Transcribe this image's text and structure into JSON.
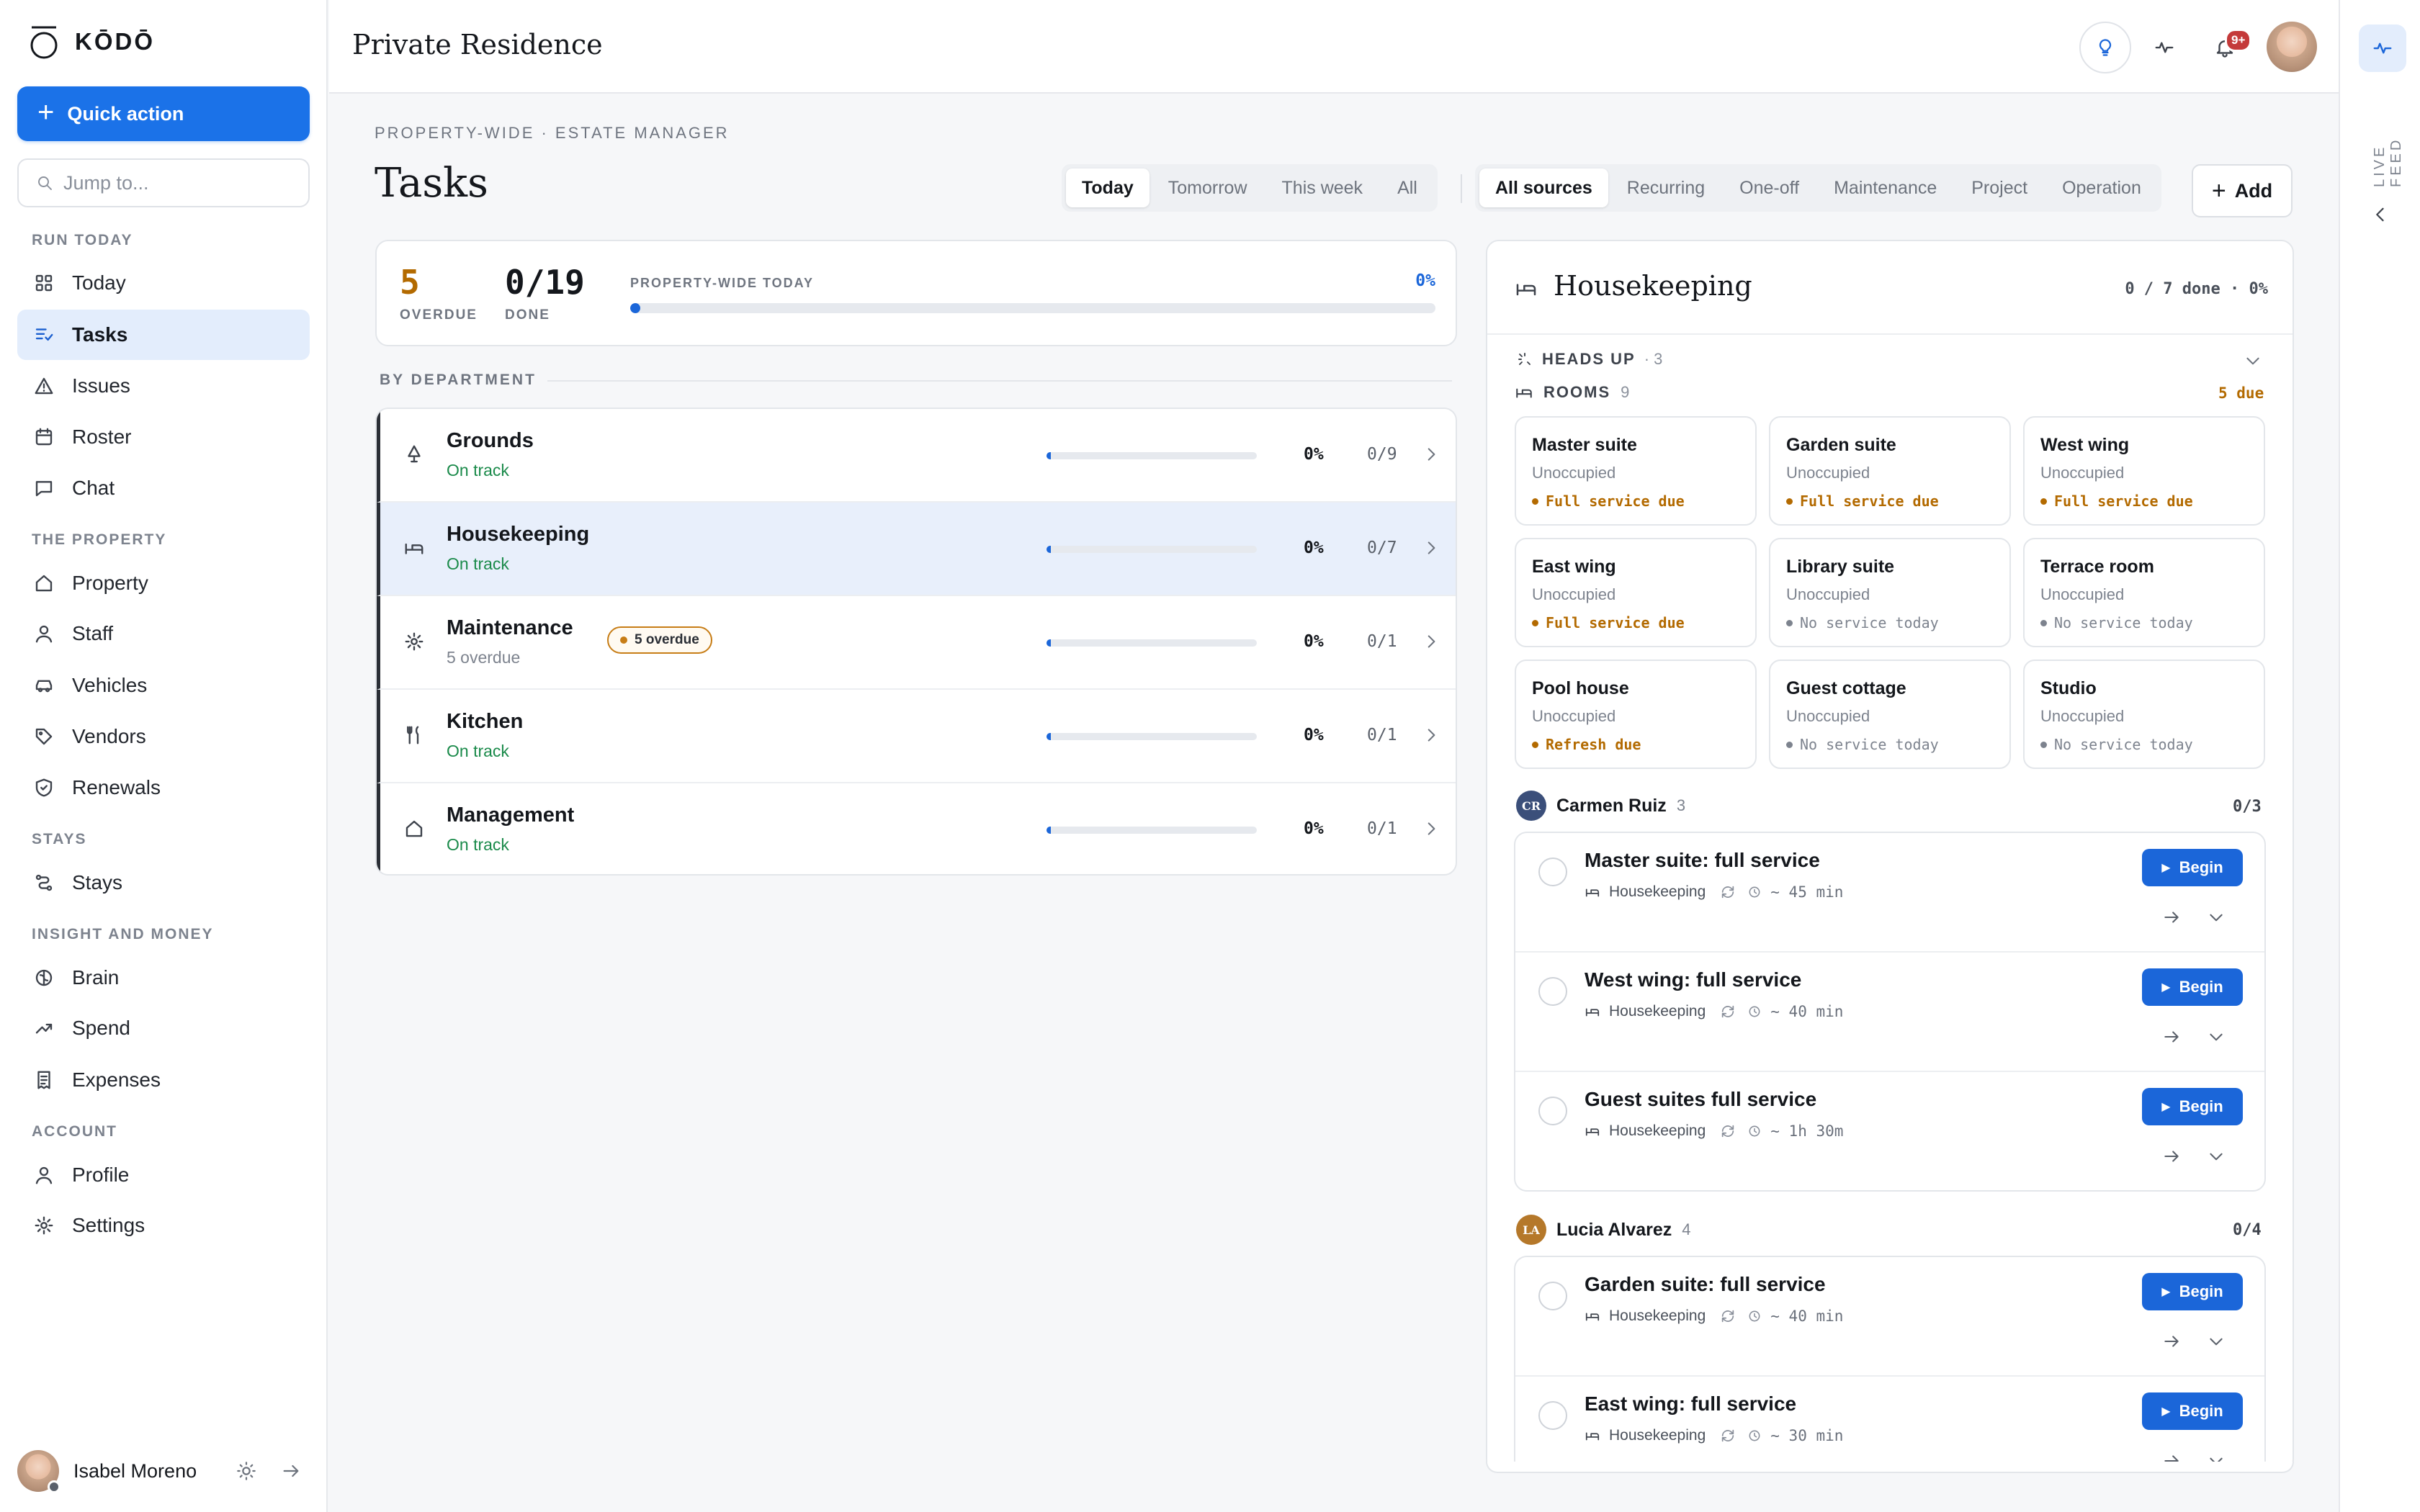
{
  "app": {
    "name": "KŌDŌ"
  },
  "sidebar": {
    "quick_action": "Quick action",
    "jump_placeholder": "Jump to...",
    "sections": {
      "run_today": "RUN TODAY",
      "the_property": "THE PROPERTY",
      "stays": "STAYS",
      "insight": "INSIGHT AND MONEY",
      "account": "ACCOUNT"
    },
    "items": {
      "today": "Today",
      "tasks": "Tasks",
      "issues": "Issues",
      "roster": "Roster",
      "chat": "Chat",
      "property": "Property",
      "staff": "Staff",
      "vehicles": "Vehicles",
      "vendors": "Vendors",
      "renewals": "Renewals",
      "stays": "Stays",
      "brain": "Brain",
      "spend": "Spend",
      "expenses": "Expenses",
      "profile": "Profile",
      "settings": "Settings"
    },
    "user": "Isabel Moreno"
  },
  "header": {
    "title": "Private Residence",
    "notif_badge": "9+"
  },
  "rail": {
    "label": "LIVE FEED"
  },
  "page": {
    "crumb": "PROPERTY-WIDE · ESTATE MANAGER",
    "title": "Tasks",
    "time_filters": [
      "Today",
      "Tomorrow",
      "This week",
      "All"
    ],
    "source_filters": [
      "All sources",
      "Recurring",
      "One-off",
      "Maintenance",
      "Project",
      "Operation"
    ],
    "add": "Add"
  },
  "summary": {
    "overdue": "5",
    "overdue_label": "OVERDUE",
    "done": "0/19",
    "done_label": "DONE",
    "progress_label": "PROPERTY-WIDE TODAY",
    "progress_pct": "0%",
    "progress_value": 0
  },
  "by_department": "BY DEPARTMENT",
  "departments": [
    {
      "name": "Grounds",
      "status": "On track",
      "pct": "0%",
      "count": "0/9"
    },
    {
      "name": "Housekeeping",
      "status": "On track",
      "pct": "0%",
      "count": "0/7"
    },
    {
      "name": "Maintenance",
      "status": "5 overdue",
      "badge": "5 overdue",
      "pct": "0%",
      "count": "0/1"
    },
    {
      "name": "Kitchen",
      "status": "On track",
      "pct": "0%",
      "count": "0/1"
    },
    {
      "name": "Management",
      "status": "On track",
      "pct": "0%",
      "count": "0/1"
    }
  ],
  "detail": {
    "title": "Housekeeping",
    "done": "0 / 7 done · 0%",
    "heads_up": "HEADS UP",
    "heads_up_count": "· 3",
    "rooms_label": "ROOMS",
    "rooms_count": "9",
    "rooms_due": "5 due",
    "rooms": [
      {
        "name": "Master suite",
        "occ": "Unoccupied",
        "status": "Full service due"
      },
      {
        "name": "Garden suite",
        "occ": "Unoccupied",
        "status": "Full service due"
      },
      {
        "name": "West wing",
        "occ": "Unoccupied",
        "status": "Full service due"
      },
      {
        "name": "East wing",
        "occ": "Unoccupied",
        "status": "Full service due"
      },
      {
        "name": "Library suite",
        "occ": "Unoccupied",
        "status": "No service today"
      },
      {
        "name": "Terrace room",
        "occ": "Unoccupied",
        "status": "No service today"
      },
      {
        "name": "Pool house",
        "occ": "Unoccupied",
        "status": "Refresh due"
      },
      {
        "name": "Guest cottage",
        "occ": "Unoccupied",
        "status": "No service today"
      },
      {
        "name": "Studio",
        "occ": "Unoccupied",
        "status": "No service today"
      }
    ],
    "people": [
      {
        "initials": "CR",
        "name": "Carmen Ruiz",
        "count": "3",
        "done": "0/3",
        "color": "#3b4f7a",
        "tasks": [
          {
            "title": "Master suite: full service",
            "dept": "Housekeeping",
            "dur": "~ 45 min"
          },
          {
            "title": "West wing: full service",
            "dept": "Housekeeping",
            "dur": "~ 40 min"
          },
          {
            "title": "Guest suites full service",
            "dept": "Housekeeping",
            "dur": "~ 1h 30m"
          }
        ]
      },
      {
        "initials": "LA",
        "name": "Lucia Alvarez",
        "count": "4",
        "done": "0/4",
        "color": "#b5782a",
        "tasks": [
          {
            "title": "Garden suite: full service",
            "dept": "Housekeeping",
            "dur": "~ 40 min"
          },
          {
            "title": "East wing: full service",
            "dept": "Housekeeping",
            "dur": "~ 30 min"
          }
        ]
      }
    ],
    "begin": "Begin"
  }
}
